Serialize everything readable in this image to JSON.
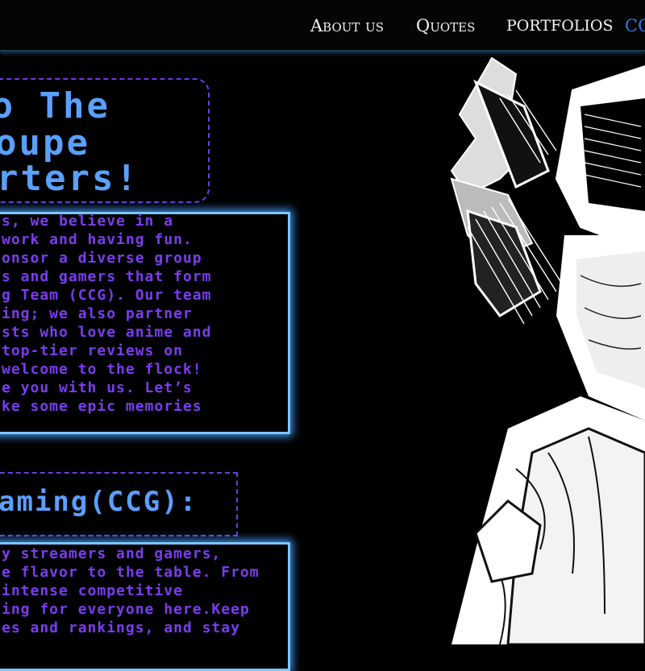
{
  "nav": {
    "about": "About us",
    "quotes": "Quotes",
    "portfolios": "PORTFOLIOS",
    "active": "CC"
  },
  "hero": {
    "title_lines": [
      "To The",
      "oupe",
      "rters!"
    ]
  },
  "about": {
    "lines": [
      "s, we believe in a",
      " work and having fun.",
      "onsor a diverse group",
      "s and gamers that form",
      "g Team (CCG). Our team",
      "ing; we also partner",
      "sts who love anime and",
      " top-tier reviews on",
      "welcome to the flock!",
      "e you with us. Let’s",
      "ke some epic memories"
    ]
  },
  "ccg": {
    "heading": "aming(CCG):",
    "lines": [
      "y streamers and gamers,",
      "e flavor to the table. From",
      "intense competitive",
      "ing for everyone here.Keep",
      "es and rankings, and stay"
    ]
  },
  "colors": {
    "accent_blue": "#5aa0ff",
    "text_purple": "#7b3cf0",
    "glow": "#7fc4ff",
    "nav_active": "#2f7de0"
  }
}
